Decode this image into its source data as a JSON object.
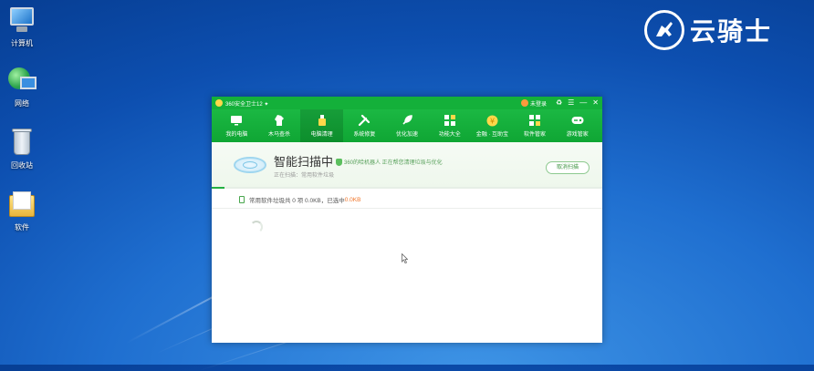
{
  "desktop": {
    "icons": [
      {
        "label": "计算机",
        "icon": "computer-icon"
      },
      {
        "label": "网络",
        "icon": "network-icon"
      },
      {
        "label": "回收站",
        "icon": "recycle-bin-icon"
      },
      {
        "label": "软件",
        "icon": "folder-icon"
      }
    ]
  },
  "logo": {
    "text": "云骑士"
  },
  "window": {
    "title": "360安全卫士12 ✦",
    "login": "未登录",
    "controls": {
      "skin": "♻",
      "menu": "☰",
      "minimize": "—",
      "close": "✕"
    },
    "nav": [
      {
        "label": "我的电脑",
        "icon": "monitor-icon"
      },
      {
        "label": "木马查杀",
        "icon": "horse-icon"
      },
      {
        "label": "电脑清理",
        "icon": "broom-icon"
      },
      {
        "label": "系统修复",
        "icon": "wrench-icon"
      },
      {
        "label": "优化加速",
        "icon": "rocket-icon"
      },
      {
        "label": "功能大全",
        "icon": "grid-icon"
      },
      {
        "label": "金融 · 互助宝",
        "icon": "coin-icon"
      },
      {
        "label": "软件管家",
        "icon": "apps-icon"
      },
      {
        "label": "游戏管家",
        "icon": "gamepad-icon"
      }
    ],
    "active_nav": 2,
    "scan": {
      "heading": "智能扫描中",
      "sub": "正在扫描：常用软件垃圾",
      "tip": "360的哈机器人 正在帮您清理垃圾与优化",
      "cancel": "取消扫描",
      "progress": 0.033
    },
    "row": {
      "label": "常用软件垃圾",
      "summary": "  共 0 项 0.0KB，已选中 ",
      "selected": "0.0KB"
    }
  },
  "colors": {
    "brand_green": "#14b03a",
    "accent_orange": "#f0762a"
  }
}
